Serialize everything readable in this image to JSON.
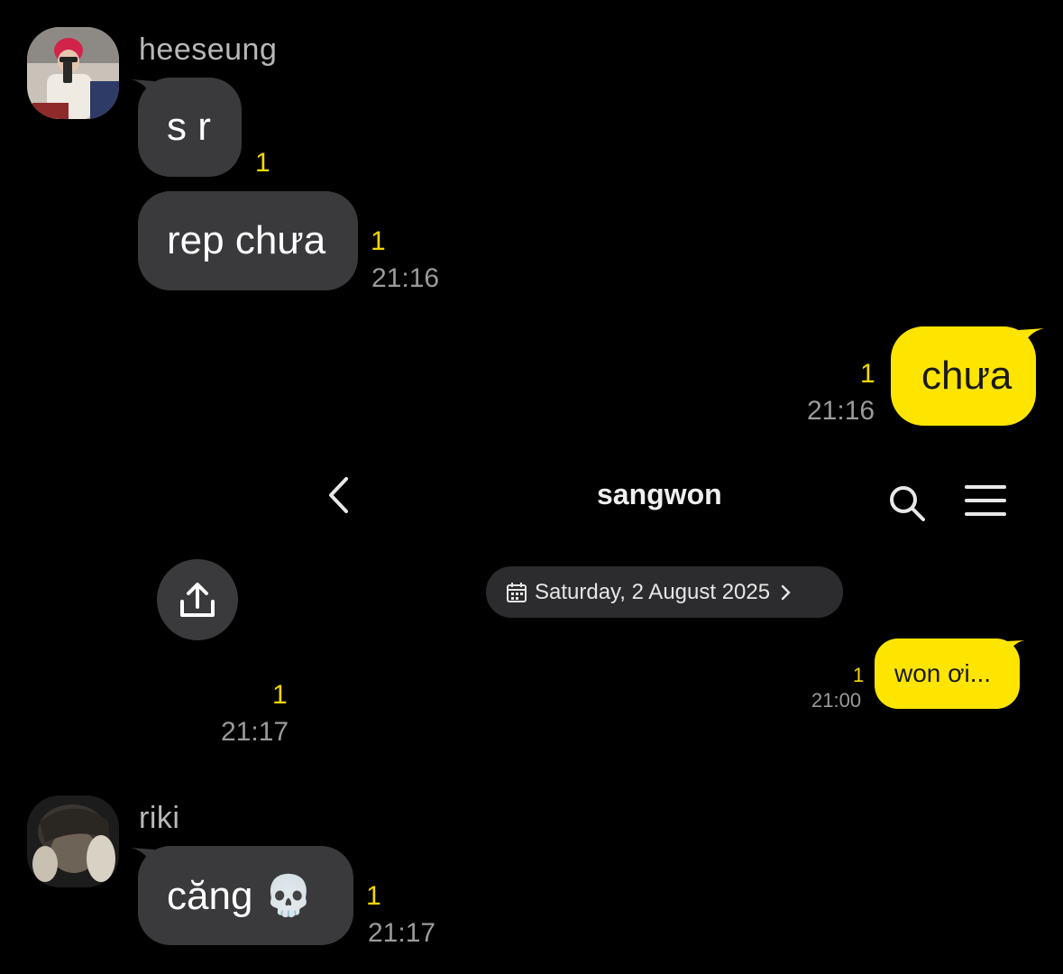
{
  "chat_top": {
    "messages": [
      {
        "sender": "heeseung",
        "text": "s r",
        "unread": "1",
        "time": ""
      },
      {
        "sender": "",
        "text": "rep chưa",
        "unread": "1",
        "time": "21:16"
      }
    ],
    "outgoing": {
      "text": "chưa",
      "unread": "1",
      "time": "21:16"
    }
  },
  "embedded": {
    "header": {
      "back_icon": "chevron-left-icon",
      "title": "sangwon",
      "search_icon": "search-icon",
      "menu_icon": "menu-icon"
    },
    "share_icon": "share-upload-icon",
    "date_label": "Saturday, 2 August 2025",
    "message": {
      "text": "won ơi...",
      "unread": "1",
      "time": "21:00"
    }
  },
  "standalone_meta": {
    "unread": "1",
    "time": "21:17"
  },
  "chat_bottom": {
    "sender": "riki",
    "text": "căng 💀",
    "unread": "1",
    "time": "21:17"
  },
  "colors": {
    "background": "#000000",
    "bubble_in": "#3a3a3c",
    "bubble_out": "#fee500",
    "unread": "#f5d800"
  }
}
